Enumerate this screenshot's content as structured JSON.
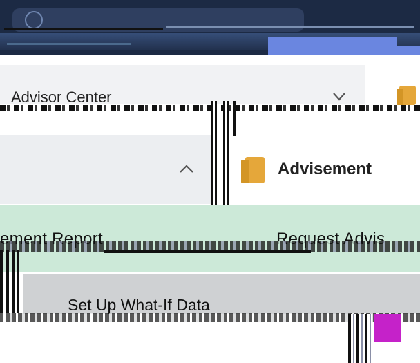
{
  "header": {
    "search_placeholder": ""
  },
  "nav": {
    "dropdown_label": "Advisor Center"
  },
  "section": {
    "title": "Advisement"
  },
  "menu": {
    "report_label": "ement Report",
    "request_label": "Request Advis",
    "whatif_label": "Set Up What-If Data"
  },
  "colors": {
    "header_bg": "#1c2a44",
    "accent_blue": "#6a86e0",
    "green_row": "#cce9d8",
    "grey_row": "#cfd1d3",
    "folder": "#e5a73a",
    "magenta": "#c522c9"
  },
  "icons": {
    "avatar": "user-avatar-icon",
    "dropdown": "chevron-down-icon",
    "collapse": "chevron-up-icon",
    "folder": "folder-icon"
  }
}
